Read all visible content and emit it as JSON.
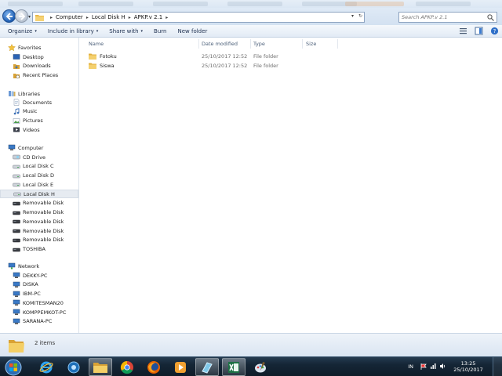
{
  "window": {
    "breadcrumb": [
      "Computer",
      "Local Disk H",
      "APKP.v 2.1"
    ],
    "search_placeholder": "Search APKP.v 2.1"
  },
  "toolbar": {
    "organize": "Organize",
    "include_in_library": "Include in library",
    "share_with": "Share with",
    "burn": "Burn",
    "new_folder": "New folder"
  },
  "nav": {
    "favorites": {
      "label": "Favorites",
      "items": [
        "Desktop",
        "Downloads",
        "Recent Places"
      ]
    },
    "libraries": {
      "label": "Libraries",
      "items": [
        "Documents",
        "Music",
        "Pictures",
        "Videos"
      ]
    },
    "computer": {
      "label": "Computer",
      "items": [
        "CD Drive",
        "Local Disk C",
        "Local Disk D",
        "Local Disk E",
        "Local Disk H",
        "Removable Disk",
        "Removable Disk",
        "Removable Disk",
        "Removable Disk",
        "Removable Disk",
        "TOSHIBA"
      ],
      "selected": "Local Disk H"
    },
    "network": {
      "label": "Network",
      "items": [
        "DEKKY-PC",
        "DISKA",
        "IBM-PC",
        "KOMITESMAN20",
        "KOMPPEMKOT-PC",
        "SARANA-PC"
      ]
    }
  },
  "columns": {
    "name": "Name",
    "date_modified": "Date modified",
    "type": "Type",
    "size": "Size"
  },
  "files": [
    {
      "name": "Fotoku",
      "date": "25/10/2017 12:52",
      "type": "File folder"
    },
    {
      "name": "Siswa",
      "date": "25/10/2017 12:52",
      "type": "File folder"
    }
  ],
  "details": {
    "count": "2 items"
  },
  "taskbar": {
    "language": "IN",
    "time": "13:25",
    "date": "25/10/2017",
    "apps": [
      "internet-explorer-icon",
      "network-app-icon",
      "file-explorer-icon",
      "chrome-icon",
      "firefox-icon",
      "media-player-icon",
      "notes-app-icon",
      "excel-icon",
      "paint-icon"
    ]
  },
  "colors": {
    "accent": "#1f5fb4",
    "folder": "#f2c65a",
    "selection": "#e6ebf1"
  }
}
